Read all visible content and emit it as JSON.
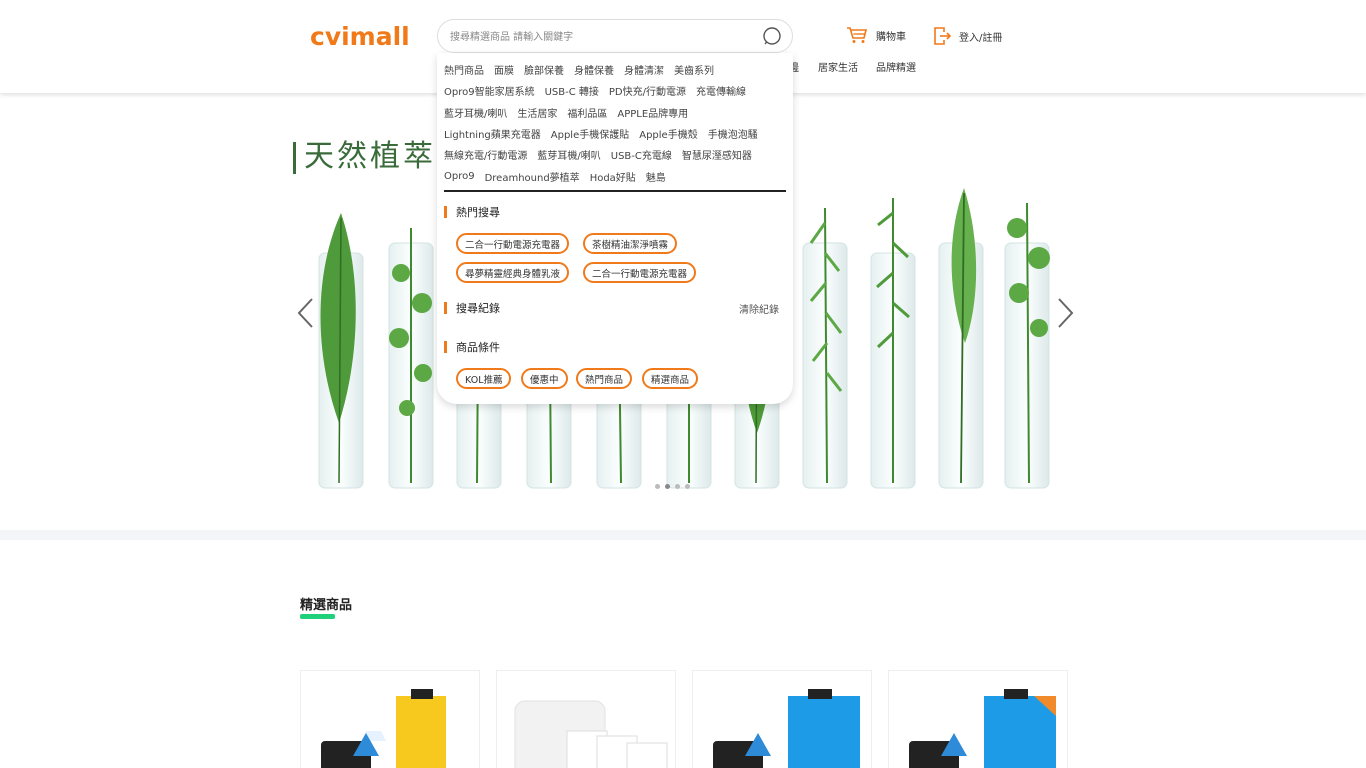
{
  "header": {
    "logo": "cvimall",
    "search_placeholder": "搜尋精選商品 請輸入關鍵字",
    "cart_label": "購物車",
    "login_label": "登入/註冊",
    "nav_items": [
      "邊",
      "居家生活",
      "品牌精選"
    ]
  },
  "banner": {
    "title": "天然植萃 D",
    "dots": 4,
    "active_dot": 1
  },
  "dropdown": {
    "keyword_rows": [
      [
        "熱門商品",
        "面膜",
        "臉部保養",
        "身體保養",
        "身體清潔",
        "美齒系列"
      ],
      [
        "Opro9智能家居系統",
        "USB-C 轉接",
        "PD快充/行動電源",
        "充電傳輸線"
      ],
      [
        "藍牙耳機/喇叭",
        "生活居家",
        "福利品區",
        "APPLE品牌專用"
      ],
      [
        "Lightning蘋果充電器",
        "Apple手機保護貼",
        "Apple手機殼",
        "手機泡泡騷"
      ],
      [
        "無線充電/行動電源",
        "藍芽耳機/喇叭",
        "USB-C充電線",
        "智慧尿溼感知器"
      ],
      [
        "Opro9",
        "Dreamhound夢植萃",
        "Hoda好貼",
        "魅島"
      ]
    ],
    "hot_search_heading": "熱門搜尋",
    "hot_searches": [
      "二合一行動電源充電器",
      "茶樹精油潔淨噴霧",
      "尋夢精靈經典身體乳液",
      "二合一行動電源充電器"
    ],
    "history_heading": "搜尋紀錄",
    "clear_history": "清除紀錄",
    "conditions_heading": "商品條件",
    "conditions": [
      "KOL推薦",
      "優惠中",
      "熱門商品",
      "精選商品"
    ]
  },
  "featured": {
    "title": "精選商品"
  },
  "colors": {
    "brand": "#f07a1a",
    "accent_green": "#1ed17a"
  }
}
